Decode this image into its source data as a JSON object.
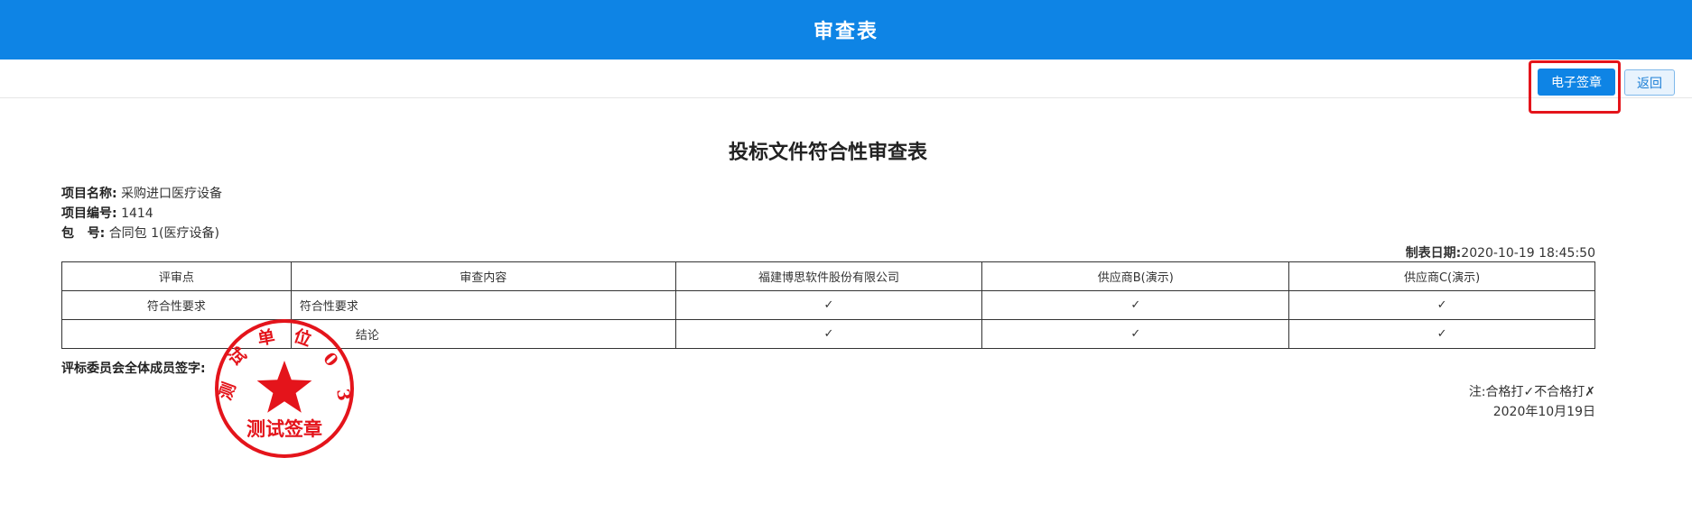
{
  "header": {
    "title": "审查表"
  },
  "toolbar": {
    "sign_label": "电子签章",
    "back_label": "返回"
  },
  "document": {
    "title": "投标文件符合性审查表",
    "project_name_label": "项目名称:",
    "project_name": "采购进口医疗设备",
    "project_no_label": "项目编号:",
    "project_no": "1414",
    "package_label": "包   号:",
    "package": "合同包 1(医疗设备)",
    "date_label": "制表日期:",
    "date": "2020-10-19 18:45:50"
  },
  "table": {
    "headers": [
      "评审点",
      "审查内容",
      "福建博思软件股份有限公司",
      "供应商B(演示)",
      "供应商C(演示)"
    ],
    "rows": [
      [
        "符合性要求",
        "符合性要求",
        "✓",
        "✓",
        "✓"
      ],
      [
        "",
        "结论",
        "✓",
        "✓",
        "✓"
      ]
    ]
  },
  "footer": {
    "sign_label": "评标委员会全体成员签字:",
    "note": "注:合格打✓不合格打✗",
    "date": "2020年10月19日"
  },
  "seal": {
    "color": "#e4141b",
    "ring_text": "测试单位03",
    "center_text": "测试签章"
  }
}
